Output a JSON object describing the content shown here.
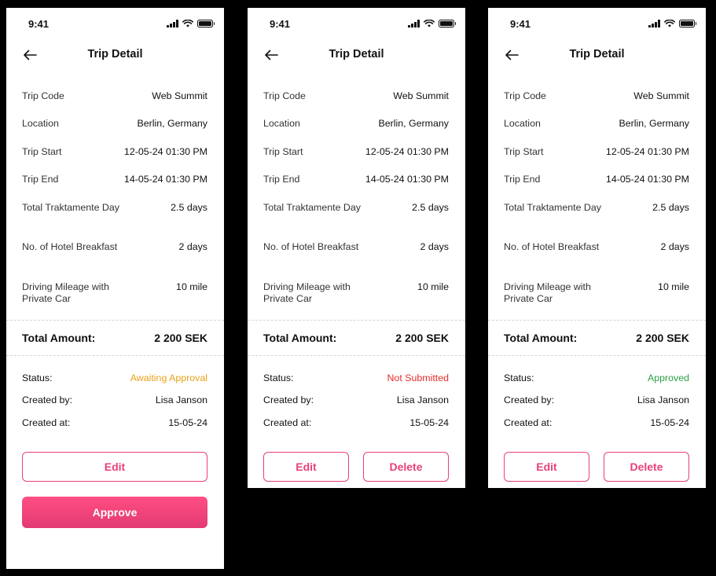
{
  "status_bar": {
    "time": "9:41"
  },
  "header": {
    "title": "Trip Detail"
  },
  "details": [
    {
      "label": "Trip Code",
      "value": "Web Summit"
    },
    {
      "label": "Location",
      "value": "Berlin, Germany"
    },
    {
      "label": "Trip Start",
      "value": "12-05-24 01:30 PM"
    },
    {
      "label": "Trip End",
      "value": "14-05-24 01:30 PM"
    },
    {
      "label": "Total Traktamente Day",
      "value": "2.5 days"
    },
    {
      "label": "No. of Hotel Breakfast",
      "value": "2 days"
    },
    {
      "label": "Driving Mileage with Private Car",
      "value": "10 mile"
    }
  ],
  "total": {
    "label": "Total Amount:",
    "value": "2 200 SEK"
  },
  "meta_labels": {
    "status": "Status:",
    "created_by": "Created by:",
    "created_at": "Created at:"
  },
  "screens": [
    {
      "status_text": "Awaiting Approval",
      "status_color": "#e8a21a",
      "created_by": "Lisa Janson",
      "created_at": "15-05-24",
      "buttons": {
        "edit": "Edit",
        "approve": "Approve"
      }
    },
    {
      "status_text": "Not Submitted",
      "status_color": "#e52b2b",
      "created_by": "Lisa Janson",
      "created_at": "15-05-24",
      "buttons": {
        "edit": "Edit",
        "delete": "Delete"
      }
    },
    {
      "status_text": "Approved",
      "status_color": "#2ea043",
      "created_by": "Lisa Janson",
      "created_at": "15-05-24",
      "buttons": {
        "edit": "Edit",
        "delete": "Delete"
      }
    }
  ],
  "icons": [
    "signal-icon",
    "wifi-icon",
    "battery-icon",
    "back-arrow-icon"
  ],
  "colors": {
    "accent": "#e8407a",
    "background": "#000000",
    "card": "#ffffff"
  }
}
